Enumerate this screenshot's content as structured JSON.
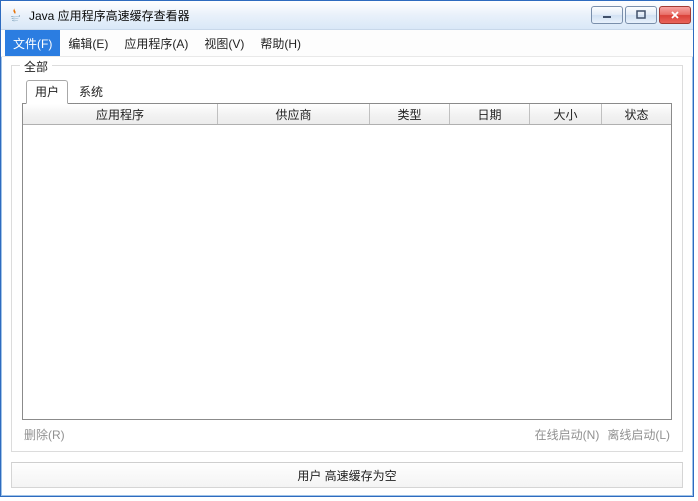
{
  "titlebar": {
    "title": "Java 应用程序高速缓存查看器"
  },
  "menu": {
    "file": "文件(F)",
    "edit": "编辑(E)",
    "app": "应用程序(A)",
    "view": "视图(V)",
    "help": "帮助(H)"
  },
  "groupbox": {
    "label": "全部"
  },
  "tabs": {
    "user": "用户",
    "system": "系统"
  },
  "columns": {
    "application": "应用程序",
    "vendor": "供应商",
    "type": "类型",
    "date": "日期",
    "size": "大小",
    "status": "状态"
  },
  "rows": [],
  "actions": {
    "delete": "删除(R)",
    "online_launch": "在线启动(N)",
    "offline_launch": "离线启动(L)"
  },
  "statusbar": {
    "text": "用户 高速缓存为空"
  }
}
